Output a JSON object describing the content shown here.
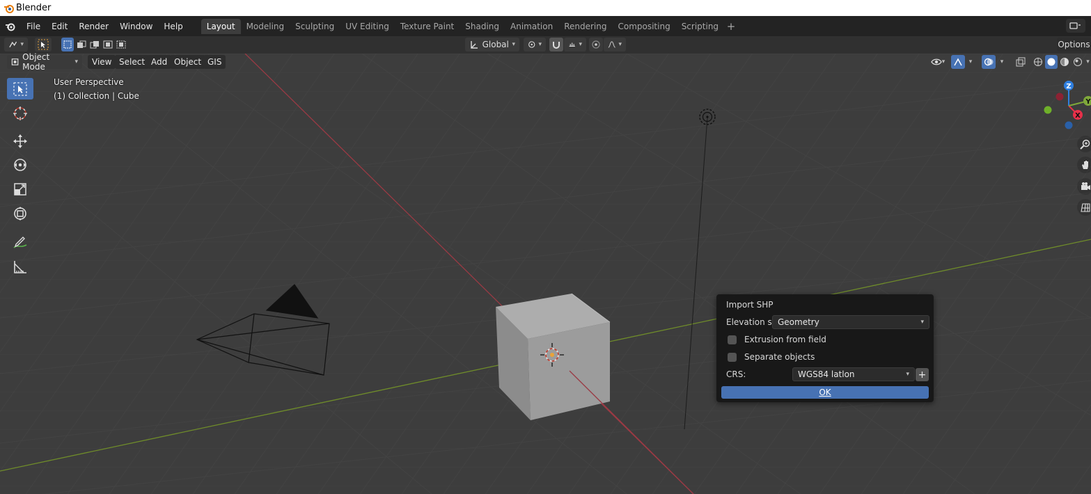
{
  "window": {
    "title": "Blender"
  },
  "menu": [
    "File",
    "Edit",
    "Render",
    "Window",
    "Help"
  ],
  "workspaces": [
    "Layout",
    "Modeling",
    "Sculpting",
    "UV Editing",
    "Texture Paint",
    "Shading",
    "Animation",
    "Rendering",
    "Compositing",
    "Scripting"
  ],
  "active_workspace": "Layout",
  "tool_header": {
    "orientation": "Global",
    "options_label": "Options"
  },
  "viewport_header": {
    "mode": "Object Mode",
    "menus": [
      "View",
      "Select",
      "Add",
      "Object",
      "GIS"
    ]
  },
  "viewport": {
    "perspective": "User Perspective",
    "collection": "(1) Collection | Cube"
  },
  "gizmo": {
    "z": "Z",
    "y": "Y",
    "x": "X"
  },
  "dialog": {
    "title": "Import SHP",
    "elevation_label": "Elevation s..",
    "elevation_value": "Geometry",
    "extrusion_label": "Extrusion from field",
    "extrusion_checked": false,
    "separate_label": "Separate objects",
    "separate_checked": false,
    "crs_label": "CRS:",
    "crs_value": "WGS84 latlon",
    "plus": "+",
    "ok_label": "OK"
  },
  "colors": {
    "accent": "#4772b3",
    "x_axis": "#b03a48",
    "y_axis": "#8aae2c",
    "background": "#3d3d3d"
  }
}
